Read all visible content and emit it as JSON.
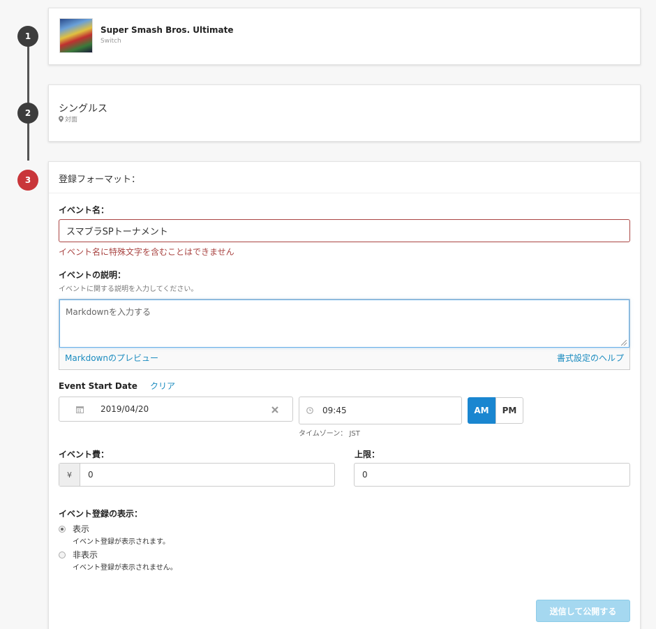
{
  "steps": [
    "1",
    "2",
    "3"
  ],
  "game": {
    "title": "Super Smash Bros. Ultimate",
    "platform": "Switch"
  },
  "event_type": {
    "title": "シングルス",
    "location_icon": "map-pin-icon",
    "location": "対面"
  },
  "registration": {
    "header": "登録フォーマット：",
    "event_name_label": "イベント名：",
    "event_name_value": "スマブラSPトーナメント",
    "event_name_error": "イベント名に特殊文字を含むことはできません",
    "description_label": "イベントの説明：",
    "description_help": "イベントに関する説明を入力してください。",
    "description_placeholder": "Markdownを入力する",
    "markdown_preview": "Markdownのプレビュー",
    "format_help": "書式設定のヘルプ",
    "start_date_label": "Event Start Date",
    "clear": "クリア",
    "date_value": "2019/04/20",
    "time_value": "09:45",
    "am": "AM",
    "pm": "PM",
    "timezone": "タイムゾーン： JST",
    "fee_label": "イベント費：",
    "currency": "¥",
    "fee_value": "0",
    "limit_label": "上限：",
    "limit_value": "0",
    "visibility_label": "イベント登録の表示：",
    "options": [
      {
        "title": "表示",
        "desc": "イベント登録が表示されます。",
        "checked": true
      },
      {
        "title": "非表示",
        "desc": "イベント登録が表示されません。",
        "checked": false
      }
    ],
    "submit": "送信して公開する"
  },
  "colors": {
    "error": "#a94442",
    "link": "#1a8bbf",
    "primary": "#1a86d0",
    "step_active": "#c9363a",
    "step_done": "#3d3d3d"
  }
}
